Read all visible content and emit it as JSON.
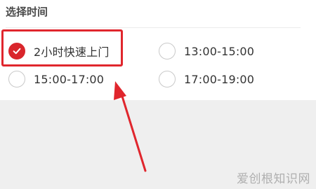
{
  "section": {
    "title": "选择时间"
  },
  "time_slots": [
    {
      "label": "2小时快速上门",
      "selected": true
    },
    {
      "label": "13:00-15:00",
      "selected": false
    },
    {
      "label": "15:00-17:00",
      "selected": false
    },
    {
      "label": "17:00-19:00",
      "selected": false
    }
  ],
  "annotation": {
    "highlight_color": "#e0262d",
    "arrow_color": "#e0262d"
  },
  "colors": {
    "accent": "#d9262c",
    "background": "#efefef",
    "card": "#ffffff"
  },
  "watermark": {
    "text": "爱创根知识网"
  }
}
